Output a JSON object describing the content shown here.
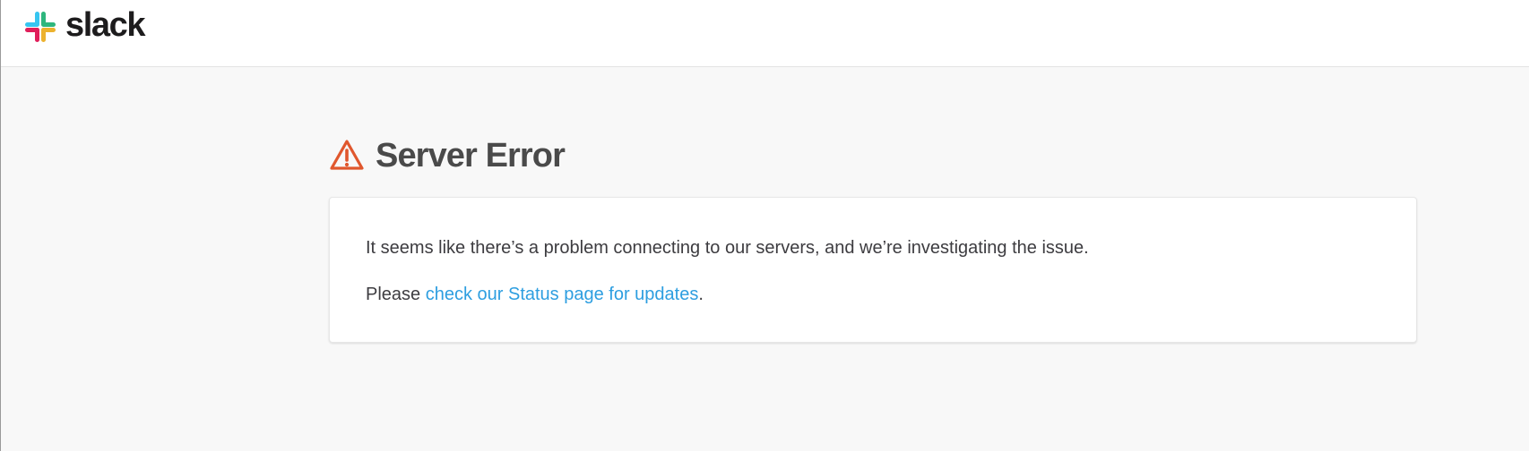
{
  "header": {
    "brand_name": "slack"
  },
  "error": {
    "title": "Server Error",
    "message": "It seems like there’s a problem connecting to our servers, and we’re investigating the issue.",
    "status_prefix": "Please ",
    "status_link_label": "check our Status page for updates",
    "status_suffix": "."
  },
  "icons": {
    "logo": "slack-logo-icon",
    "warning": "warning-triangle-icon"
  },
  "colors": {
    "page_background": "#f8f8f8",
    "card_background": "#ffffff",
    "title_text": "#4a4a4a",
    "link": "#2d9ee0",
    "warning": "#e0572d",
    "slack_blue": "#36c5f0",
    "slack_green": "#2eb67d",
    "slack_yellow": "#ecb22e",
    "slack_red": "#e01e5a"
  }
}
